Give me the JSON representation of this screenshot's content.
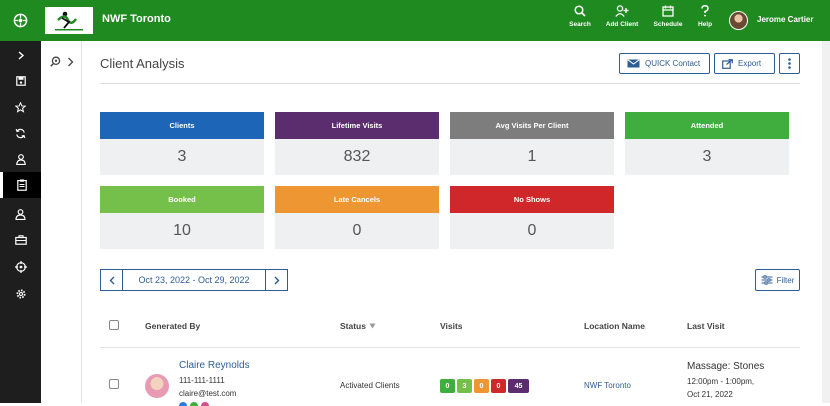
{
  "topbar": {
    "brand": "NWF Toronto",
    "nav": [
      {
        "label": "Search",
        "icon": "search-icon"
      },
      {
        "label": "Add Client",
        "icon": "add-client-icon"
      },
      {
        "label": "Schedule",
        "icon": "calendar-icon"
      },
      {
        "label": "Help",
        "icon": "help-icon"
      }
    ],
    "user_name": "Jerome Cartier"
  },
  "sidebar": {
    "items": [
      "expand-icon",
      "save-icon",
      "star-icon",
      "refresh-icon",
      "user-icon",
      "clipboard-icon",
      "staff-icon",
      "briefcase-icon",
      "target-icon",
      "gear-icon"
    ]
  },
  "page": {
    "title": "Client Analysis",
    "quick_contact": "QUICK Contact",
    "export": "Export"
  },
  "cards": [
    {
      "label": "Clients",
      "value": "3",
      "color": "#1c65b7"
    },
    {
      "label": "Lifetime Visits",
      "value": "832",
      "color": "#5b2d6e"
    },
    {
      "label": "Avg Visits Per Client",
      "value": "1",
      "color": "#7d7d7d"
    },
    {
      "label": "Attended",
      "value": "3",
      "color": "#3fae3f"
    },
    {
      "label": "Booked",
      "value": "10",
      "color": "#74c04a"
    },
    {
      "label": "Late Cancels",
      "value": "0",
      "color": "#ee9632"
    },
    {
      "label": "No Shows",
      "value": "0",
      "color": "#d0282a"
    }
  ],
  "date_range": "Oct 23, 2022 - Oct 29, 2022",
  "filter_label": "Filter",
  "table": {
    "headers": {
      "generated_by": "Generated By",
      "status": "Status",
      "visits": "Visits",
      "location": "Location Name",
      "last_visit": "Last Visit"
    },
    "rows": [
      {
        "name": "Claire Reynolds",
        "phone": "111-111-1111",
        "email": "claire@test.com",
        "status": "Activated Clients",
        "visits": [
          {
            "value": "0",
            "color": "#3fae3f"
          },
          {
            "value": "3",
            "color": "#74c04a"
          },
          {
            "value": "0",
            "color": "#ee9632"
          },
          {
            "value": "0",
            "color": "#d0282a"
          },
          {
            "value": "45",
            "color": "#5b2d6e"
          }
        ],
        "location": "NWF Toronto",
        "last_visit_service": "Massage: Stones",
        "last_visit_time": "12:00pm - 1:00pm,",
        "last_visit_date": "Oct 21, 2022"
      }
    ]
  }
}
